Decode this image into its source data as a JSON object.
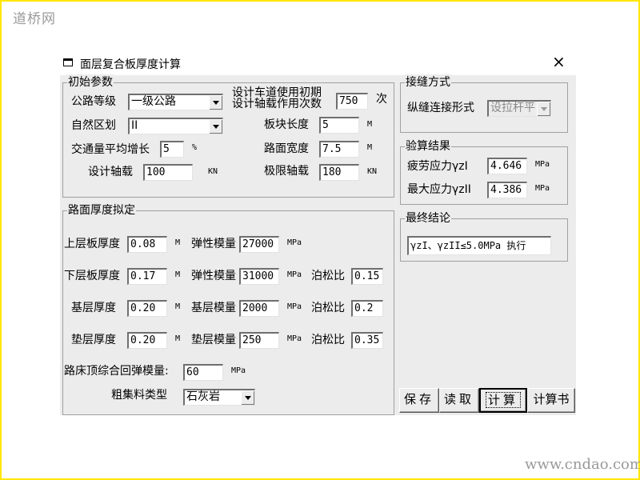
{
  "watermark": {
    "top_left": "道桥网",
    "bottom_right": "www.cndao.com"
  },
  "window": {
    "title": "面层复合板厚度计算",
    "close_label": "×"
  },
  "initial": {
    "legend": "初始参数",
    "road_grade_label": "公路等级",
    "road_grade_value": "一级公路",
    "region_label": "自然区划",
    "region_value": "II",
    "traffic_growth_label": "交通量平均增长",
    "traffic_growth_value": "5",
    "traffic_growth_unit": "%",
    "axle_label": "设计轴载",
    "axle_value": "100",
    "axle_unit": "KN",
    "lane_line1": "设计车道使用初期",
    "lane_line2": "设计轴载作用次数",
    "lane_value": "750",
    "lane_unit": "次",
    "slab_length_label": "板块长度",
    "slab_length_value": "5",
    "slab_length_unit": "M",
    "road_width_label": "路面宽度",
    "road_width_value": "7.5",
    "road_width_unit": "M",
    "limit_axle_label": "极限轴载",
    "limit_axle_value": "180",
    "limit_axle_unit": "KN"
  },
  "thickness": {
    "legend": "路面厚度拟定",
    "rows": [
      {
        "label": "上层板厚度",
        "value": "0.08",
        "unit": "M",
        "mod_label": "弹性模量",
        "mod_value": "27000",
        "mod_unit": "MPa"
      },
      {
        "label": "下层板厚度",
        "value": "0.17",
        "unit": "M",
        "mod_label": "弹性模量",
        "mod_value": "31000",
        "mod_unit": "MPa",
        "pois_label": "泊松比",
        "pois_value": "0.15"
      },
      {
        "label": "基层厚度",
        "value": "0.20",
        "unit": "M",
        "mod_label": "基层模量",
        "mod_value": "2000",
        "mod_unit": "MPa",
        "pois_label": "泊松比",
        "pois_value": "0.2"
      },
      {
        "label": "垫层厚度",
        "value": "0.20",
        "unit": "M",
        "mod_label": "垫层模量",
        "mod_value": "250",
        "mod_unit": "MPa",
        "pois_label": "泊松比",
        "pois_value": "0.35"
      }
    ],
    "subgrade_label": "路床顶综合回弹模量:",
    "subgrade_value": "60",
    "subgrade_unit": "MPa",
    "aggregate_label": "粗集料类型",
    "aggregate_value": "石灰岩"
  },
  "joint": {
    "legend": "接缝方式",
    "label": "纵缝连接形式",
    "value": "设拉杆平"
  },
  "check": {
    "legend": "验算结果",
    "fatigue_label": "疲劳应力γzI",
    "fatigue_value": "4.646",
    "fatigue_unit": "MPa",
    "max_label": "最大应力γzII",
    "max_value": "4.386",
    "max_unit": "MPa"
  },
  "conclusion": {
    "legend": "最终结论",
    "text": "γzI、γzII≤5.0MPa 执行"
  },
  "buttons": {
    "save": "保存",
    "read": "读取",
    "calc": "计算",
    "report": "计算书"
  }
}
